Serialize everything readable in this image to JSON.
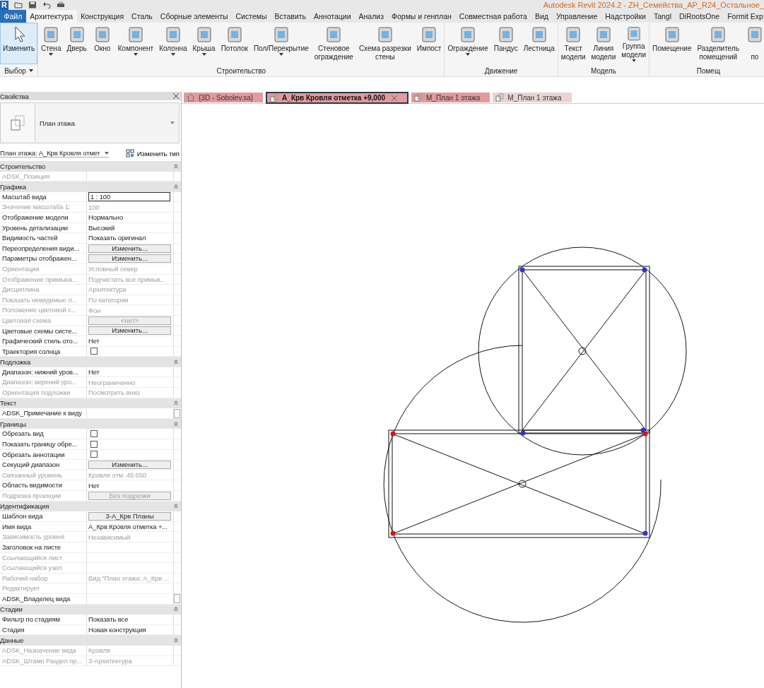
{
  "window": {
    "title": "Autodesk Revit 2024.2 - ZH_Семейства_АР_R24_Остальное_",
    "logo": "R"
  },
  "menu_tabs": [
    {
      "label": "Файл",
      "kind": "file",
      "selected": false
    },
    {
      "label": "Архитектура",
      "kind": "tab",
      "selected": true
    },
    {
      "label": "Конструкция",
      "kind": "tab",
      "selected": false
    },
    {
      "label": "Сталь",
      "kind": "tab",
      "selected": false
    },
    {
      "label": "Сборные элементы",
      "kind": "tab",
      "selected": false
    },
    {
      "label": "Системы",
      "kind": "tab",
      "selected": false
    },
    {
      "label": "Вставить",
      "kind": "tab",
      "selected": false
    },
    {
      "label": "Аннотации",
      "kind": "tab",
      "selected": false
    },
    {
      "label": "Анализ",
      "kind": "tab",
      "selected": false
    },
    {
      "label": "Формы и генплан",
      "kind": "tab",
      "selected": false
    },
    {
      "label": "Совместная работа",
      "kind": "tab",
      "selected": false
    },
    {
      "label": "Вид",
      "kind": "tab",
      "selected": false
    },
    {
      "label": "Управление",
      "kind": "tab",
      "selected": false
    },
    {
      "label": "Надстройки",
      "kind": "tab",
      "selected": false
    },
    {
      "label": "Tangl",
      "kind": "tab",
      "selected": false
    },
    {
      "label": "DiRootsOne",
      "kind": "tab",
      "selected": false
    },
    {
      "label": "Formit Exp",
      "kind": "tab",
      "selected": false
    }
  ],
  "ribbon_panels": [
    {
      "title": "Выбор",
      "title_dropdown": true,
      "tools": [
        {
          "label": "Изменить",
          "selected": true,
          "dropdown": false
        }
      ]
    },
    {
      "title": "Строительство",
      "title_dropdown": false,
      "tools": [
        {
          "label": "Стена",
          "selected": false,
          "dropdown": true
        },
        {
          "label": "Дверь",
          "selected": false,
          "dropdown": false
        },
        {
          "label": "Окно",
          "selected": false,
          "dropdown": false
        },
        {
          "label": "Компонент",
          "selected": false,
          "dropdown": true
        },
        {
          "label": "Колонна",
          "selected": false,
          "dropdown": true
        },
        {
          "label": "Крыша",
          "selected": false,
          "dropdown": true
        },
        {
          "label": "Потолок",
          "selected": false,
          "dropdown": false
        },
        {
          "label": "Пол/Перекрытие",
          "selected": false,
          "dropdown": true
        },
        {
          "label": "Стеновое\nограждение",
          "selected": false,
          "dropdown": false
        },
        {
          "label": "Схема разрезки\nстены",
          "selected": false,
          "dropdown": false
        },
        {
          "label": "Импост",
          "selected": false,
          "dropdown": false
        }
      ]
    },
    {
      "title": "Движение",
      "title_dropdown": false,
      "tools": [
        {
          "label": "Ограждение",
          "selected": false,
          "dropdown": true
        },
        {
          "label": "Пандус",
          "selected": false,
          "dropdown": false
        },
        {
          "label": "Лестница",
          "selected": false,
          "dropdown": false
        }
      ]
    },
    {
      "title": "Модель",
      "title_dropdown": false,
      "tools": [
        {
          "label": "Текст\nмодели",
          "selected": false,
          "dropdown": false
        },
        {
          "label": "Линия\nмодели",
          "selected": false,
          "dropdown": false
        },
        {
          "label": "Группа\nмодели",
          "selected": false,
          "dropdown": true
        }
      ]
    },
    {
      "title": "Помещ",
      "title_dropdown": false,
      "tools": [
        {
          "label": "Помещение",
          "selected": false,
          "dropdown": false
        },
        {
          "label": "Разделитель\nпомещений",
          "selected": false,
          "dropdown": false
        },
        {
          "label": "\nпо",
          "selected": false,
          "dropdown": false
        }
      ]
    }
  ],
  "properties": {
    "title": "Свойства",
    "type_name": "План этажа",
    "instance_selector": "План этажа: А_Крв Кровля отмет",
    "edit_type": "Изменить тип",
    "groups": [
      {
        "name": "Строительство",
        "rows": [
          {
            "label": "ADSK_Позиция",
            "kind": "text",
            "disabled": true
          }
        ]
      },
      {
        "name": "Графика",
        "rows": [
          {
            "label": "Масштаб вида",
            "value": "1 : 100",
            "kind": "field",
            "disabled": false
          },
          {
            "label": "Значение масштаба    1:",
            "value": "100",
            "kind": "text",
            "disabled": true
          },
          {
            "label": "Отображение модели",
            "value": "Нормально",
            "kind": "text",
            "disabled": false
          },
          {
            "label": "Уровень детализации",
            "value": "Высокий",
            "kind": "text",
            "disabled": false
          },
          {
            "label": "Видимость частей",
            "value": "Показать оригинал",
            "kind": "text",
            "disabled": false
          },
          {
            "label": "Переопределения види...",
            "value": "Изменить...",
            "kind": "button",
            "disabled": false
          },
          {
            "label": "Параметры отображен...",
            "value": "Изменить...",
            "kind": "button",
            "disabled": false
          },
          {
            "label": "Ориентация",
            "value": "Условный север",
            "kind": "text",
            "disabled": true
          },
          {
            "label": "Отображение примыка...",
            "value": "Подчистить все примык...",
            "kind": "text",
            "disabled": true
          },
          {
            "label": "Дисциплина",
            "value": "Архитектура",
            "kind": "text",
            "disabled": true
          },
          {
            "label": "Показать невидимые л...",
            "value": "По категории",
            "kind": "text",
            "disabled": true
          },
          {
            "label": "Положение цветовой с...",
            "value": "Фон",
            "kind": "text",
            "disabled": true
          },
          {
            "label": "Цветовая схема",
            "value": "<нет>",
            "kind": "button",
            "disabled": true
          },
          {
            "label": "Цветовые схемы систе...",
            "value": "Изменить...",
            "kind": "button",
            "disabled": false
          },
          {
            "label": "Графический стиль ото...",
            "value": "Нет",
            "kind": "text",
            "disabled": false
          },
          {
            "label": "Траектория солнца",
            "kind": "checkbox",
            "checked": false,
            "disabled": false
          }
        ]
      },
      {
        "name": "Подложка",
        "rows": [
          {
            "label": "Диапазон: нижний уров...",
            "value": "Нет",
            "kind": "text",
            "disabled": false
          },
          {
            "label": "Диапазон: верхний уро...",
            "value": "Неограниченно",
            "kind": "text",
            "disabled": true
          },
          {
            "label": "Ориентация подложки",
            "value": "Посмотреть вниз",
            "kind": "text",
            "disabled": true
          }
        ]
      },
      {
        "name": "Текст",
        "rows": [
          {
            "label": "ADSK_Примечание к виду",
            "kind": "editable",
            "disabled": false
          }
        ]
      },
      {
        "name": "Границы",
        "rows": [
          {
            "label": "Обрезать вид",
            "kind": "checkbox",
            "checked": false,
            "disabled": false
          },
          {
            "label": "Показать границу обре...",
            "kind": "checkbox",
            "checked": false,
            "disabled": false
          },
          {
            "label": "Обрезать аннотации",
            "kind": "checkbox",
            "checked": false,
            "disabled": false
          },
          {
            "label": "Секущий диапазон",
            "value": "Изменить...",
            "kind": "button",
            "disabled": false
          },
          {
            "label": "Связанный уровень",
            "value": "Кровля отм. 45.650",
            "kind": "text",
            "disabled": true
          },
          {
            "label": "Область видимости",
            "value": "Нет",
            "kind": "text",
            "disabled": false
          },
          {
            "label": "Подрезка проекции",
            "value": "Без подрезки",
            "kind": "button",
            "disabled": true
          }
        ]
      },
      {
        "name": "Идентификация",
        "rows": [
          {
            "label": "Шаблон вида",
            "value": "3-А_Крв Планы",
            "kind": "button",
            "disabled": false
          },
          {
            "label": "Имя вида",
            "value": "А_Крв Кровля отметка +...",
            "kind": "text",
            "disabled": false
          },
          {
            "label": "Зависимость уровня",
            "value": "Независимый",
            "kind": "text",
            "disabled": true
          },
          {
            "label": "Заголовок на листе",
            "kind": "text",
            "disabled": false
          },
          {
            "label": "Ссылающийся лист",
            "kind": "text",
            "disabled": true
          },
          {
            "label": "Ссылающийся узел",
            "kind": "text",
            "disabled": true
          },
          {
            "label": "Рабочий набор",
            "value": "Вид \"План этажа: А_Крв ...",
            "kind": "text",
            "disabled": true
          },
          {
            "label": "Редактирует",
            "kind": "text",
            "disabled": true
          },
          {
            "label": "ADSK_Владелец вида",
            "kind": "editable",
            "disabled": false
          }
        ]
      },
      {
        "name": "Стадии",
        "rows": [
          {
            "label": "Фильтр по стадиям",
            "value": "Показать все",
            "kind": "text",
            "disabled": false
          },
          {
            "label": "Стадия",
            "value": "Новая конструкция",
            "kind": "text",
            "disabled": false
          }
        ]
      },
      {
        "name": "Данные",
        "rows": [
          {
            "label": "ADSK_Назначение вида",
            "value": "Кровля",
            "kind": "text",
            "disabled": true
          },
          {
            "label": "ADSK_Штамп Раздел пр...",
            "value": "3-Архитектура",
            "kind": "text",
            "disabled": true
          }
        ]
      }
    ]
  },
  "view_tabs": [
    {
      "label": "{3D - Sobolev.sa}",
      "kind": "model",
      "selected": false,
      "color": "#e29a9a"
    },
    {
      "label": "А_Крв Кровля отметка +9,000",
      "kind": "plan",
      "selected": true,
      "color": "#e29a9a"
    },
    {
      "label": "М_План 1 этажа",
      "kind": "plan",
      "selected": false,
      "color": "#e29a9a"
    },
    {
      "label": "М_План 1 этажа",
      "kind": "plan",
      "selected": false,
      "color": "#ead3d3"
    }
  ]
}
